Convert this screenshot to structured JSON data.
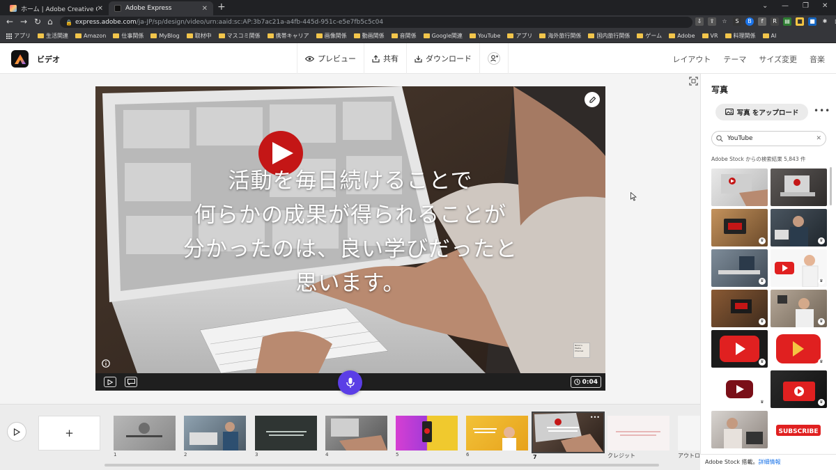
{
  "browser": {
    "tabs": [
      {
        "title": "ホーム | Adobe Creative Cloud",
        "active": false,
        "favicon_color": "#e34f6f"
      },
      {
        "title": "Adobe Express",
        "active": true,
        "favicon_color": "#111111"
      }
    ],
    "url_domain": "express.adobe.com",
    "url_path": "/ja-JP/sp/design/video/urn:aaid:sc:AP:3b7ac21a-a4fb-445d-951c-e5e7fb5c5c04",
    "bookmarks": [
      "アプリ",
      "生活関連",
      "Amazon",
      "仕事関係",
      "MyBlog",
      "取材中",
      "マスコミ関係",
      "携帯キャリア",
      "画像関係",
      "動画関係",
      "音関係",
      "Google関連",
      "YouTube",
      "アプリ",
      "海外旅行関係",
      "国内旅行関係",
      "ゲーム",
      "Adobe",
      "VR",
      "料理関係",
      "AI"
    ]
  },
  "app": {
    "project_title": "ビデオ",
    "actions": {
      "preview": "プレビュー",
      "share": "共有",
      "download": "ダウンロード"
    },
    "right_nav": [
      "レイアウト",
      "テーマ",
      "サイズ変更",
      "音楽"
    ]
  },
  "preview": {
    "caption_lines": [
      "活動を毎日続けることで",
      "何らかの成果が得られることが",
      "分かったのは、良い学びだったと",
      "思います。"
    ],
    "duration": "0:04",
    "watermark_text": "Nikon's Media Channel"
  },
  "panel": {
    "title": "写真",
    "upload_label": "写真 をアップロード",
    "search_value": "YouTube",
    "result_count": "Adobe Stock からの検索結果 5,843 件",
    "footer_text": "Adobe Stock 搭載。",
    "footer_link": "詳細情報"
  },
  "timeline": {
    "add_label": "+",
    "scenes": [
      {
        "num": "1",
        "selected": false
      },
      {
        "num": "2",
        "selected": false
      },
      {
        "num": "3",
        "selected": false
      },
      {
        "num": "4",
        "selected": false
      },
      {
        "num": "5",
        "selected": false
      },
      {
        "num": "6",
        "selected": false
      },
      {
        "num": "7",
        "selected": true
      },
      {
        "num": "クレジット",
        "selected": false
      },
      {
        "num": "アウトロ",
        "selected": false
      }
    ]
  },
  "colors": {
    "accent_mic": "#5b3ee6",
    "youtube_red": "#e02020"
  }
}
